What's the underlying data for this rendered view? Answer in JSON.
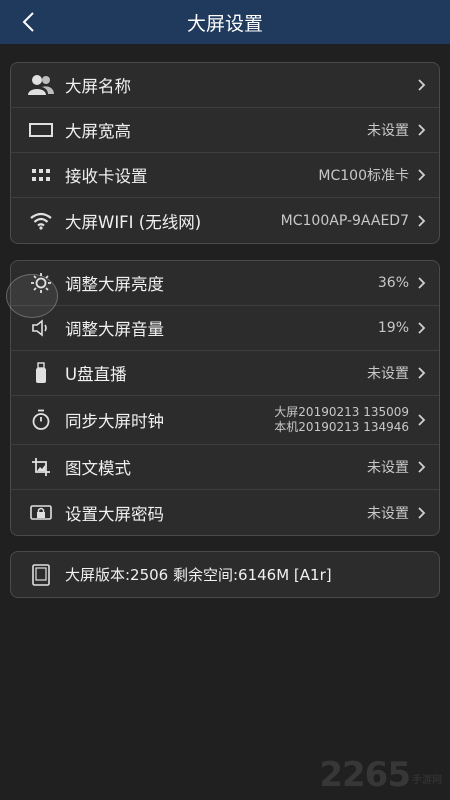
{
  "header": {
    "title": "大屏设置",
    "back_icon": "chevron-left-icon"
  },
  "group1": [
    {
      "icon": "users-icon",
      "label": "大屏名称",
      "value": ""
    },
    {
      "icon": "rectangle-icon",
      "label": "大屏宽高",
      "value": "未设置"
    },
    {
      "icon": "grid-dots-icon",
      "label": "接收卡设置",
      "value": "MC100标准卡"
    },
    {
      "icon": "wifi-icon",
      "label": "大屏WIFI (无线网)",
      "value": "MC100AP-9AAED7"
    }
  ],
  "group2": [
    {
      "icon": "brightness-icon",
      "label": "调整大屏亮度",
      "value": "36%"
    },
    {
      "icon": "volume-icon",
      "label": "调整大屏音量",
      "value": "19%"
    },
    {
      "icon": "usb-icon",
      "label": "U盘直播",
      "value": "未设置"
    },
    {
      "icon": "stopwatch-icon",
      "label": "同步大屏时钟",
      "value_line1": "大屏20190213 135009",
      "value_line2": "本机20190213 134946"
    },
    {
      "icon": "crop-icon",
      "label": "图文模式",
      "value": "未设置"
    },
    {
      "icon": "lock-screen-icon",
      "label": "设置大屏密码",
      "value": "未设置"
    }
  ],
  "group3": {
    "icon": "book-icon",
    "label": "大屏版本:2506 剩余空间:6146M [A1r]"
  },
  "watermark": {
    "big": "2265",
    "small": "手游网"
  },
  "colors": {
    "header_bg": "#1f3a5c",
    "page_bg": "#202020",
    "card_bg": "#2c2c2c"
  }
}
